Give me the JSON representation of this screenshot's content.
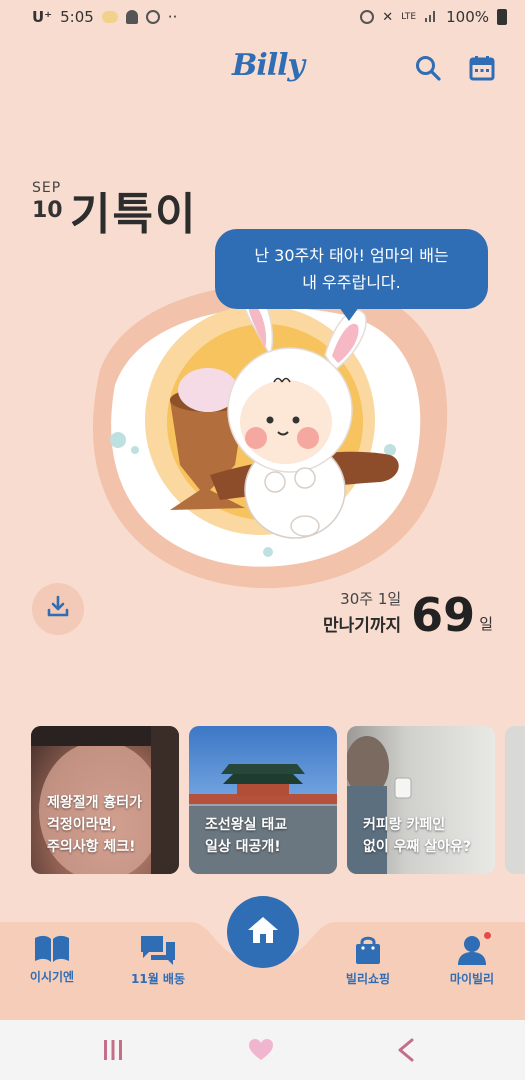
{
  "status_bar": {
    "carrier": "U⁺",
    "time": "5:05",
    "extra_left": "··",
    "network": "LTE",
    "battery": "100%"
  },
  "header": {
    "logo": "Billy"
  },
  "diary": {
    "month": "SEP",
    "day": "10",
    "nickname": "기특이"
  },
  "speech_bubble": {
    "line1": "난 30주차 태아! 엄마의 배는",
    "line2": "내 우주랍니다."
  },
  "dday": {
    "week_day": "30주 1일",
    "until_label": "만나기까지",
    "days": "69",
    "unit": "일"
  },
  "cards": [
    {
      "line1": "제왕절개 흉터가",
      "line2": "걱정이라면,",
      "line3": "주의사항 체크!"
    },
    {
      "line1": "조선왕실 태교",
      "line2": "일상 대공개!",
      "line3": ""
    },
    {
      "line1": "커피랑 카페인",
      "line2": "없이 우째 살아유?",
      "line3": ""
    }
  ],
  "bottom_nav": {
    "items": [
      {
        "label": "이시기엔",
        "icon": "book-icon"
      },
      {
        "label": "11월 배동",
        "icon": "chat-icon"
      },
      {
        "label": "",
        "icon": "home-icon"
      },
      {
        "label": "빌리쇼핑",
        "icon": "shopping-bag-icon"
      },
      {
        "label": "마이빌리",
        "icon": "person-icon"
      }
    ]
  },
  "colors": {
    "background": "#f8dccf",
    "accent": "#2f6db4",
    "notification": "#e34b4b"
  }
}
